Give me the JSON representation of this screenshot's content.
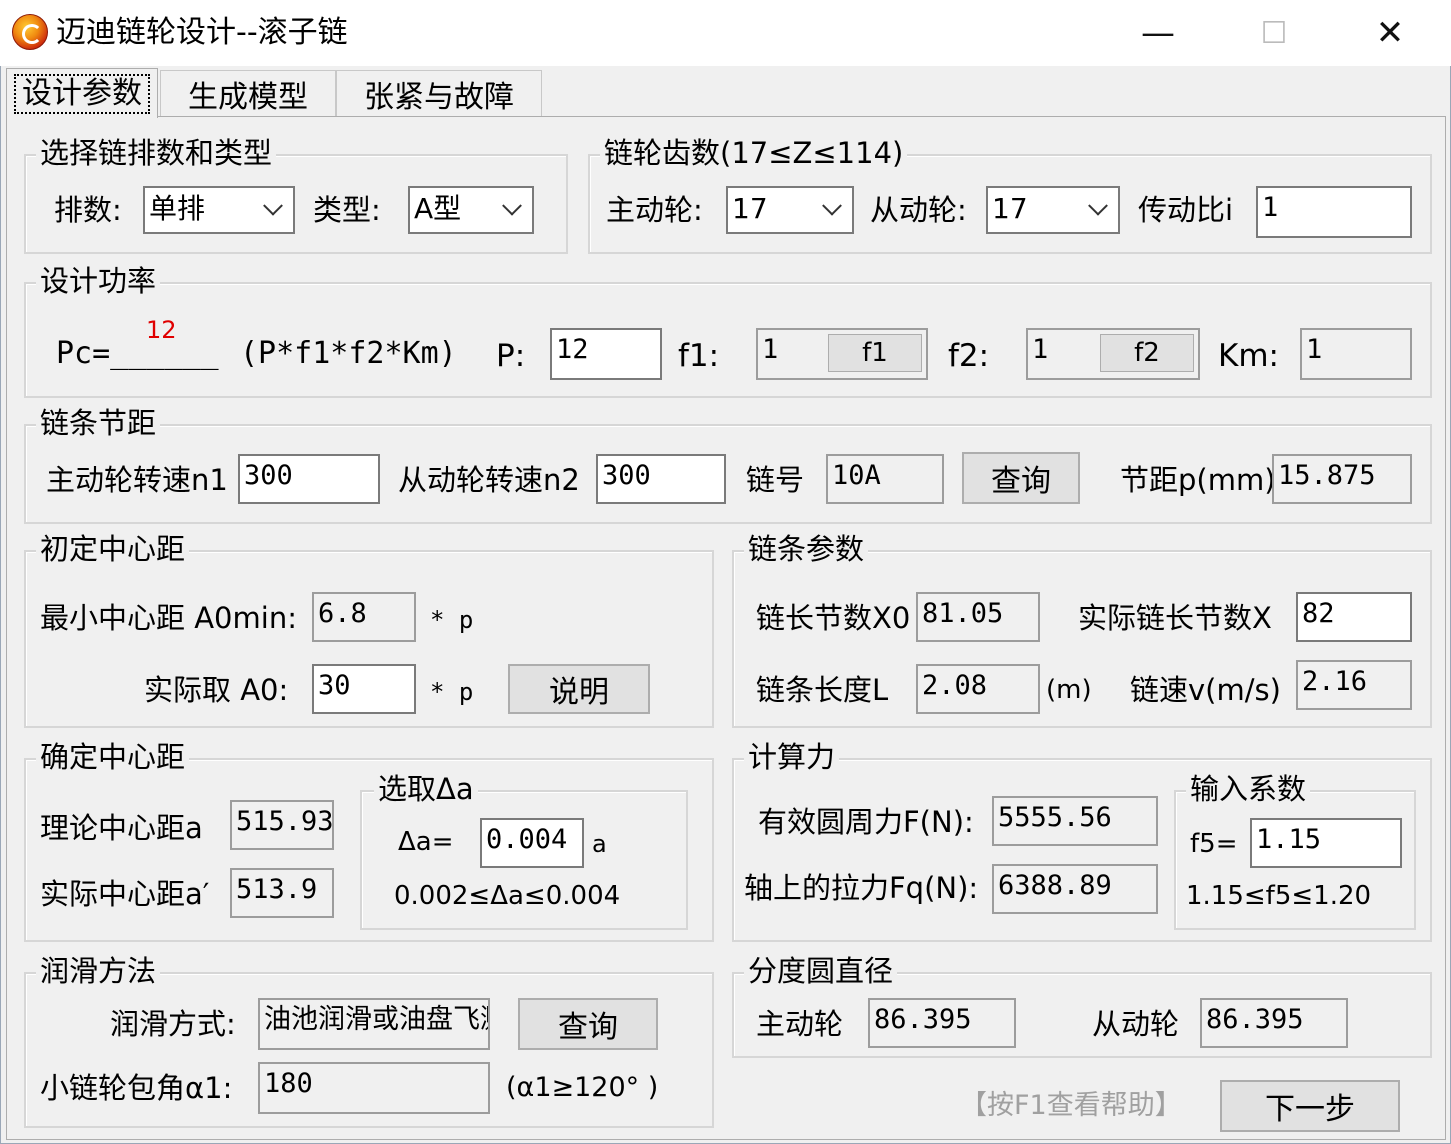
{
  "window": {
    "title": "迈迪链轮设计--滚子链",
    "minimize": "—",
    "maximize": "☐",
    "close": "✕"
  },
  "tabs": [
    {
      "label": "设计参数"
    },
    {
      "label": "生成模型"
    },
    {
      "label": "张紧与故障"
    }
  ],
  "chain_type": {
    "title": "选择链排数和类型",
    "rows_label": "排数:",
    "rows_value": "单排",
    "type_label": "类型:",
    "type_value": "A型"
  },
  "teeth": {
    "title": "链轮齿数(17≤Z≤114)",
    "driver_label": "主动轮:",
    "driver_value": "17",
    "driven_label": "从动轮:",
    "driven_value": "17",
    "ratio_label": "传动比i",
    "ratio_value": "1"
  },
  "power": {
    "title": "设计功率",
    "pc_value": "12",
    "formula_left": "Pc=______",
    "formula_right": "(P*f1*f2*Km)",
    "p_label": "P:",
    "p_value": "12",
    "f1_label": "f1:",
    "f1_value": "1",
    "f1_button": "f1",
    "f2_label": "f2:",
    "f2_value": "1",
    "f2_button": "f2",
    "km_label": "Km:",
    "km_value": "1"
  },
  "pitch": {
    "title": "链条节距",
    "n1_label": "主动轮转速n1",
    "n1_value": "300",
    "n2_label": "从动轮转速n2",
    "n2_value": "300",
    "chain_no_label": "链号",
    "chain_no_value": "10A",
    "query_button": "查询",
    "pitch_label": "节距p(mm)",
    "pitch_value": "15.875"
  },
  "initial_center": {
    "title": "初定中心距",
    "min_label": "最小中心距 A0min:",
    "min_value": "6.8",
    "min_unit": "* p",
    "actual_label": "实际取 A0:",
    "actual_value": "30",
    "actual_unit": "* p",
    "explain_button": "说明"
  },
  "chain_params": {
    "title": "链条参数",
    "x0_label": "链长节数X0",
    "x0_value": "81.05",
    "x_label": "实际链长节数X",
    "x_value": "82",
    "length_label": "链条长度L",
    "length_value": "2.08",
    "length_unit": "(m)",
    "speed_label": "链速v(m/s)",
    "speed_value": "2.16"
  },
  "center": {
    "title": "确定中心距",
    "theory_label": "理论中心距a",
    "theory_value": "515.93",
    "actual_label": "实际中心距a′",
    "actual_value": "513.9",
    "delta_title": "选取Δa",
    "delta_label": "Δa=",
    "delta_value": "0.004",
    "delta_unit": "a",
    "delta_range": "0.002≤Δa≤0.004"
  },
  "force": {
    "title": "计算力",
    "f_label": "有效圆周力F(N):",
    "f_value": "5555.56",
    "fq_label": "轴上的拉力Fq(N):",
    "fq_value": "6388.89",
    "coef_title": "输入系数",
    "f5_label": "f5=",
    "f5_value": "1.15",
    "f5_range": "1.15≤f5≤1.20"
  },
  "lube": {
    "title": "润滑方法",
    "method_label": "润滑方式:",
    "method_value": "油池润滑或油盘飞溅润滑",
    "query_button": "查询",
    "wrap_label": "小链轮包角α1:",
    "wrap_value": "180",
    "wrap_range": "(α1≥120° )"
  },
  "pitch_dia": {
    "title": "分度圆直径",
    "driver_label": "主动轮",
    "driver_value": "86.395",
    "driven_label": "从动轮",
    "driven_value": "86.395"
  },
  "footer": {
    "help_text": "【按F1查看帮助】",
    "next_button": "下一步"
  }
}
